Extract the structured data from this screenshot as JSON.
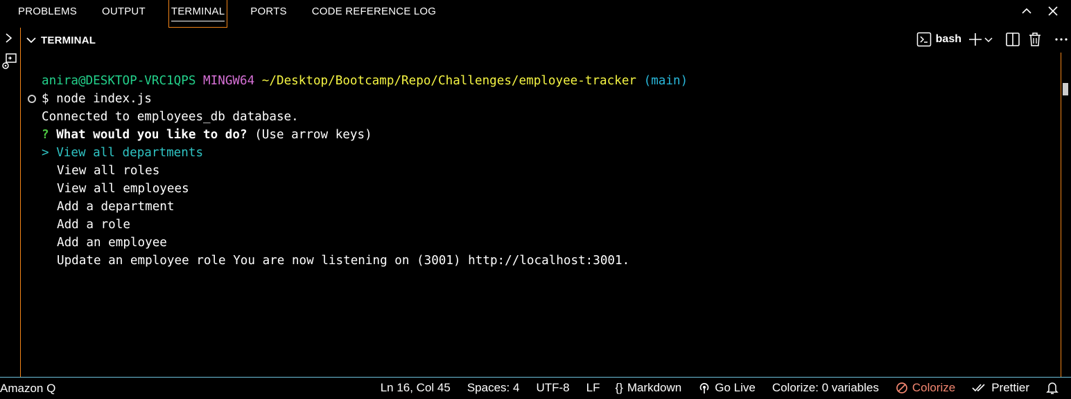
{
  "tabs": [
    {
      "label": "PROBLEMS"
    },
    {
      "label": "OUTPUT"
    },
    {
      "label": "TERMINAL"
    },
    {
      "label": "PORTS"
    },
    {
      "label": "CODE REFERENCE LOG"
    }
  ],
  "panel_title": "TERMINAL",
  "terminal_profile": "bash",
  "prompt": {
    "user_host": "anira@DESKTOP-VRC1QPS",
    "env": "MINGW64",
    "path": "~/Desktop/Bootcamp/Repo/Challenges/employee-tracker",
    "branch": "(main)"
  },
  "command": "$ node index.js",
  "output": {
    "connected": "Connected to employees_db database.",
    "question_mark": "?",
    "question": "What would you like to do?",
    "hint": "(Use arrow keys)",
    "pointer": ">",
    "choices": [
      "View all departments",
      "View all roles",
      "View all employees",
      "Add a department",
      "Add a role",
      "Add an employee",
      "Update an employee role You are now listening on (3001) http://localhost:3001."
    ]
  },
  "statusbar": {
    "left": "Amazon Q",
    "ln_col": "Ln 16, Col 45",
    "spaces": "Spaces: 4",
    "encoding": "UTF-8",
    "eol": "LF",
    "language_braces": "{}",
    "language": "Markdown",
    "golive": "Go Live",
    "colorize_vars": "Colorize: 0 variables",
    "colorize": "Colorize",
    "prettier": "Prettier"
  },
  "colors": {
    "accent_border": "#f38518",
    "status_border": "#6fc3df",
    "green": "#23d18b",
    "magenta": "#d670d6",
    "yellow": "#f5f543",
    "cyan": "#29b8db"
  }
}
